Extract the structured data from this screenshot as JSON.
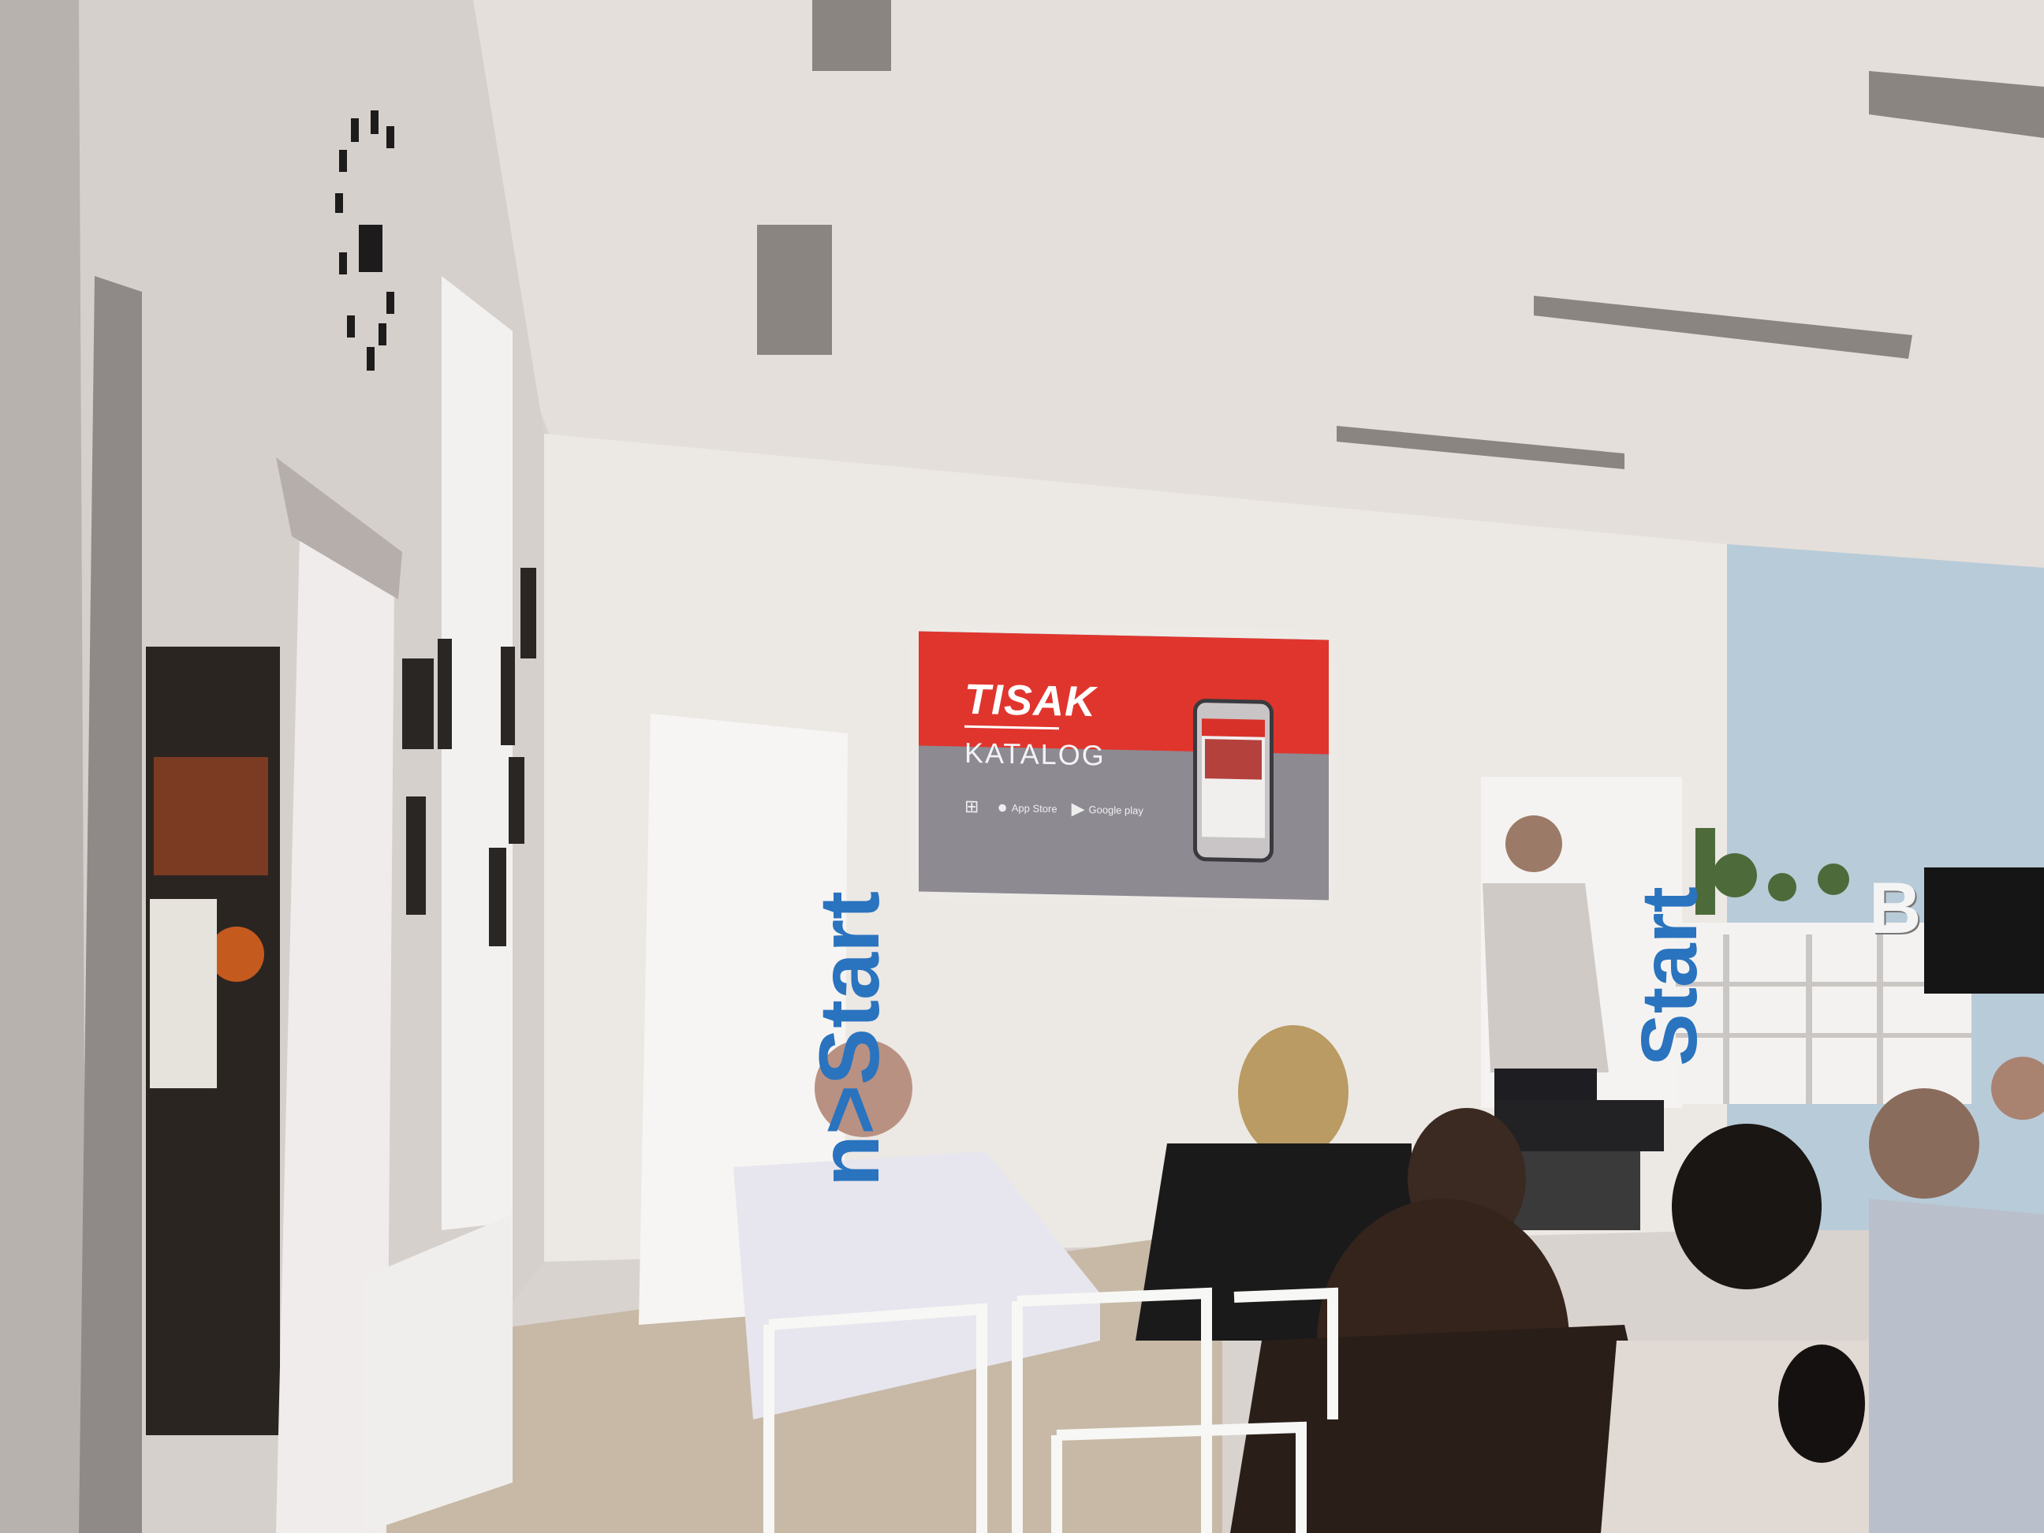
{
  "slide": {
    "title": "TISAK",
    "subtitle": "KATALOG",
    "stores": [
      {
        "icon": "windows-store-icon",
        "label": ""
      },
      {
        "icon": "apple-icon",
        "label": "App Store"
      },
      {
        "icon": "google-play-icon",
        "label": "Google play"
      }
    ]
  },
  "banners": {
    "left_text": "n>Start",
    "right_text": "Start"
  },
  "shelf_letter": "B",
  "colors": {
    "slide_red": "#e0352d",
    "slide_grey": "#8d8a92",
    "banner_blue": "#2a73bf",
    "wall": "#ece8e4",
    "ceiling": "#e6e1dd",
    "blue_wall": "#b7ccd9"
  }
}
